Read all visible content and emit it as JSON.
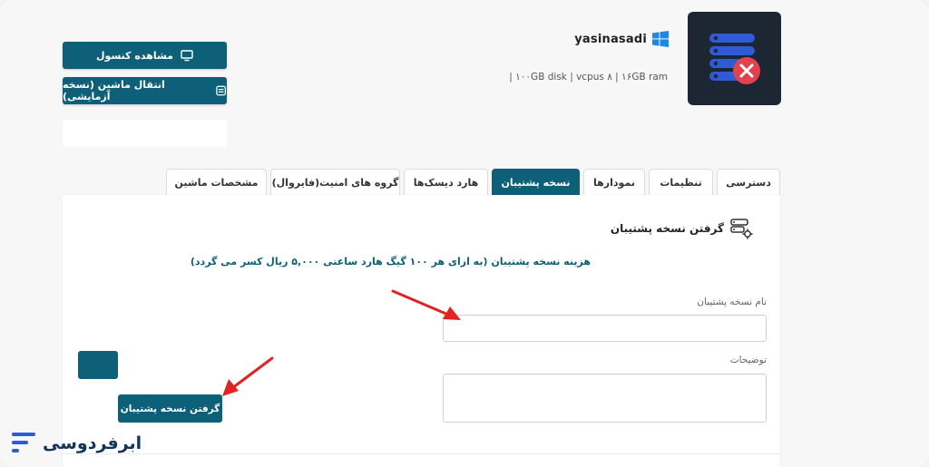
{
  "server": {
    "name": "yasinasadi",
    "specs": "| ۱۰۰GB disk | vcpus ۸ | ۱۶GB ram",
    "os_icon": "windows-icon",
    "status_icon": "server-error-icon"
  },
  "header_buttons": {
    "console_label": "مشاهده کنسول",
    "migrate_label": "انتقال ماشین (نسخه آزمایشی)"
  },
  "tabs": [
    {
      "label": "دسترسی",
      "active": false
    },
    {
      "label": "تنظیمات",
      "active": false
    },
    {
      "label": "نمودارها",
      "active": false
    },
    {
      "label": "نسخه پشتیبان",
      "active": true
    },
    {
      "label": "هارد دیسک‌ها",
      "active": false
    },
    {
      "label": "گروه های امنیت(فایروال)",
      "active": false
    },
    {
      "label": "مشخصات ماشین",
      "active": false
    }
  ],
  "backup": {
    "title": "گرفتن نسخه پشتیبان",
    "notice": "هزینه نسخه پشتیبان (به ازای هر ۱۰۰ گیگ هارد ساعتی ۵,۰۰۰ ریال کسر می گردد)",
    "name_label": "نام نسخه پشتیبان",
    "name_value": "",
    "desc_label": "توضیحات",
    "desc_value": "",
    "submit_label": "گرفتن نسخه پشتیبان"
  },
  "brand": {
    "name": "ابرفردوسی"
  },
  "colors": {
    "primary": "#0d6077",
    "annotation_arrow": "#e02424",
    "thumb_bg": "#1c2733",
    "error": "#e0424f"
  }
}
